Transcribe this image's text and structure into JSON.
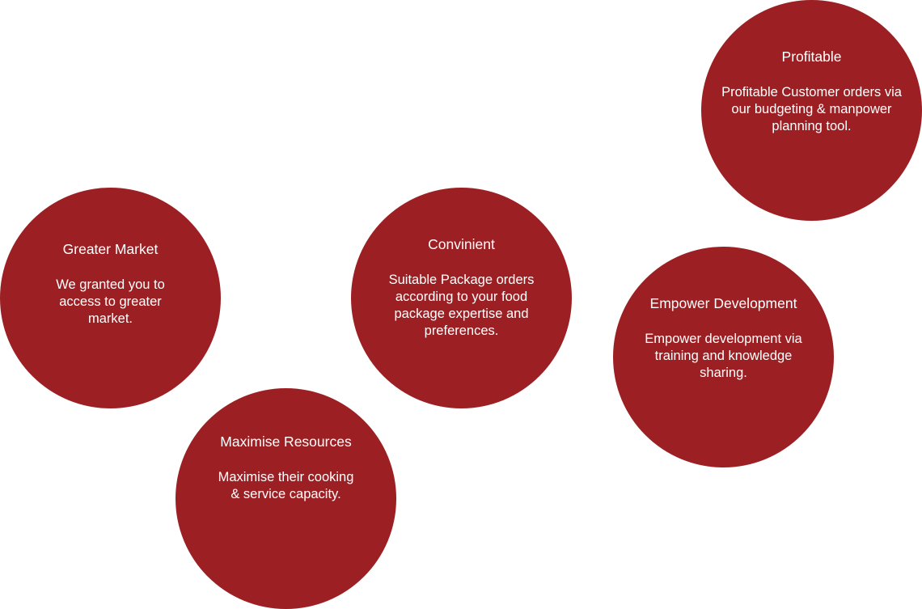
{
  "colors": {
    "circle_fill": "#9c2023",
    "text": "#ffffff",
    "background": "#ffffff"
  },
  "circles": [
    {
      "title": "Profitable",
      "description": "Profitable Customer orders via our budgeting & manpower planning tool."
    },
    {
      "title": "Greater Market",
      "description": "We granted you to access to greater market."
    },
    {
      "title": "Convinient",
      "description": "Suitable Package orders according to your food package expertise and preferences."
    },
    {
      "title": "Empower Development",
      "description": "Empower development via training and knowledge sharing."
    },
    {
      "title": "Maximise Resources",
      "description": "Maximise their cooking & service capacity."
    }
  ]
}
